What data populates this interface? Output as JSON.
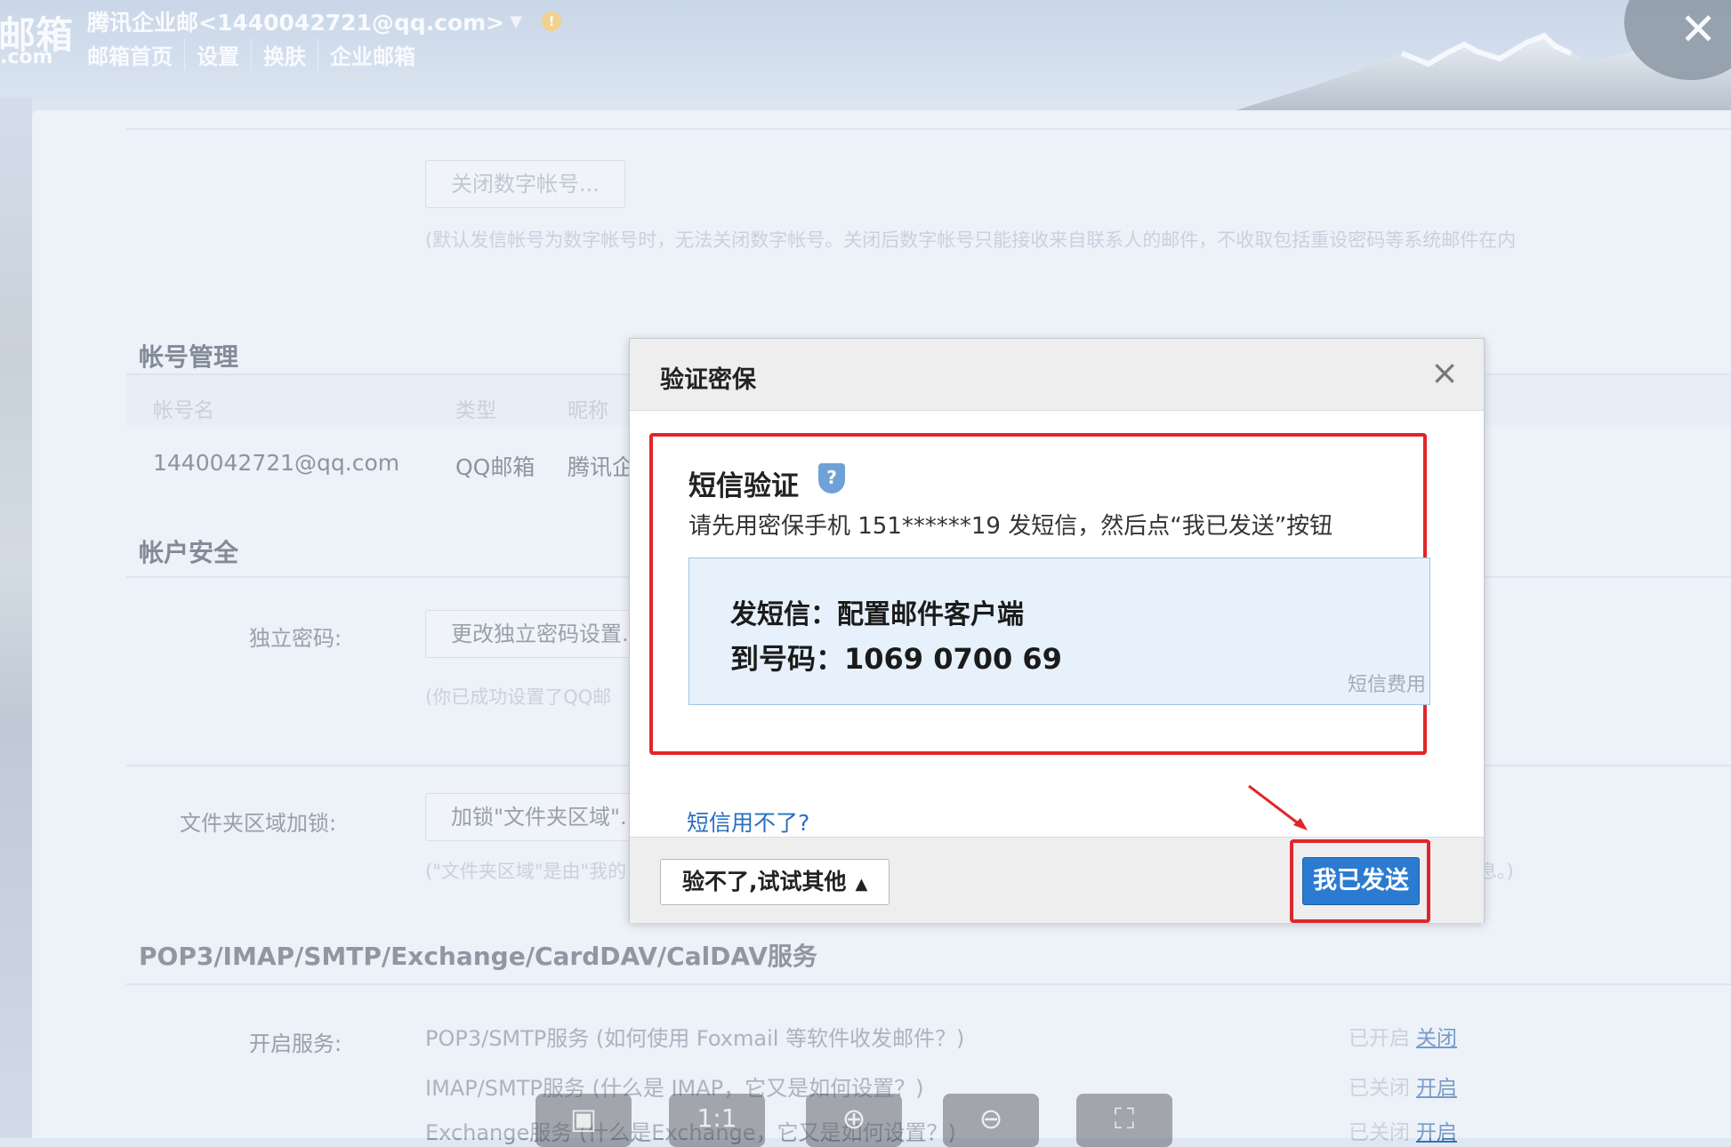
{
  "app": {
    "logo_main": "邮箱",
    "logo_sub": ".com",
    "account": "腾讯企业邮<1440042721@qq.com>",
    "nav": [
      "邮箱首页",
      "设置",
      "换肤",
      "企业邮箱"
    ]
  },
  "page": {
    "close_digital_button": "关闭数字帐号...",
    "close_digital_hint": "(默认发信帐号为数字帐号时，无法关闭数字帐号。关闭后数字帐号只能接收来自联系人的邮件，不收取包括重设密码等系统邮件在内",
    "account_mgmt_title": "帐号管理",
    "table_headers": [
      "帐号名",
      "类型",
      "昵称"
    ],
    "table_row": {
      "name": "1440042721@qq.com",
      "type": "QQ邮箱",
      "nick": "腾讯企"
    },
    "security_title": "帐户安全",
    "independent_pwd_label": "独立密码:",
    "independent_pwd_button": "更改独立密码设置...",
    "independent_pwd_hint": "(你已成功设置了QQ邮",
    "folder_lock_label": "文件夹区域加锁:",
    "folder_lock_button": "加锁\"文件夹区域\"...",
    "folder_lock_hint": "(\"文件夹区域\"是由\"我的",
    "folder_lock_hint_end": "息。)",
    "services_title": "POP3/IMAP/SMTP/Exchange/CardDAV/CalDAV服务",
    "services_label": "开启服务:",
    "services": [
      {
        "text": "POP3/SMTP服务 (如何使用 Foxmail 等软件收发邮件？)",
        "status": "已开启",
        "action": "关闭"
      },
      {
        "text": "IMAP/SMTP服务 (什么是 IMAP，它又是如何设置？)",
        "status": "已关闭",
        "action": "开启"
      },
      {
        "text": "Exchange服务 (什么是Exchange，它又是如何设置？)",
        "status": "已关闭",
        "action": "开启"
      }
    ]
  },
  "dialog": {
    "title": "验证密保",
    "sms_title": "短信验证",
    "instruction": "请先用密保手机 151******19 发短信，然后点“我已发送”按钮",
    "sms_content": "发短信：配置邮件客户端",
    "sms_number": "到号码：1069 0700 69",
    "fee_text": "短信费用",
    "cannot_use_link": "短信用不了?",
    "alt_button": "验不了,试试其他",
    "sent_button": "我已发送"
  },
  "viewer_toolbar": [
    "1:1"
  ],
  "colors": {
    "accent_blue": "#2b7bd0",
    "highlight_red": "#e0262b",
    "link_blue": "#2a6fbf"
  }
}
